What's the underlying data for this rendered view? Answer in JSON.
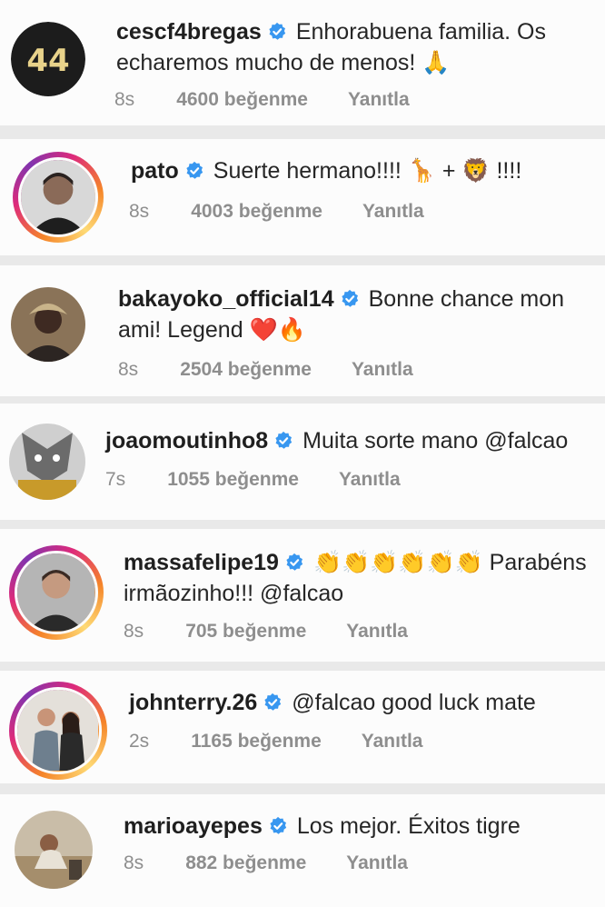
{
  "comments": [
    {
      "username": "cescf4bregas",
      "text": "Enhorabuena familia. Os echaremos mucho de menos! 🙏",
      "time": "8s",
      "likes": "4600 beğenme",
      "reply": "Yanıtla"
    },
    {
      "username": "pato",
      "text": "Suerte hermano!!!! 🦒 + 🦁 !!!!",
      "time": "8s",
      "likes": "4003 beğenme",
      "reply": "Yanıtla"
    },
    {
      "username": "bakayoko_official14",
      "text": "Bonne chance mon ami! Legend ❤️🔥",
      "time": "8s",
      "likes": "2504 beğenme",
      "reply": "Yanıtla"
    },
    {
      "username": "joaomoutinho8",
      "text": "Muita sorte mano @falcao",
      "time": "7s",
      "likes": "1055 beğenme",
      "reply": "Yanıtla"
    },
    {
      "username": "massafelipe19",
      "text": "👏👏👏👏👏👏 Parabéns irmãozinho!!! @falcao",
      "time": "8s",
      "likes": "705 beğenme",
      "reply": "Yanıtla"
    },
    {
      "username": "johnterry.26",
      "text": "@falcao good luck mate",
      "time": "2s",
      "likes": "1165 beğenme",
      "reply": "Yanıtla"
    },
    {
      "username": "marioayepes",
      "text": "Los mejor. Éxitos tigre",
      "time": "8s",
      "likes": "882 beğenme",
      "reply": "Yanıtla"
    }
  ],
  "colors": {
    "verified": "#3897f0",
    "meta": "#8e8e8e",
    "background": "#e9e9e9",
    "card": "#fcfcfc"
  },
  "icons": {
    "verified": "verified-badge-icon"
  }
}
